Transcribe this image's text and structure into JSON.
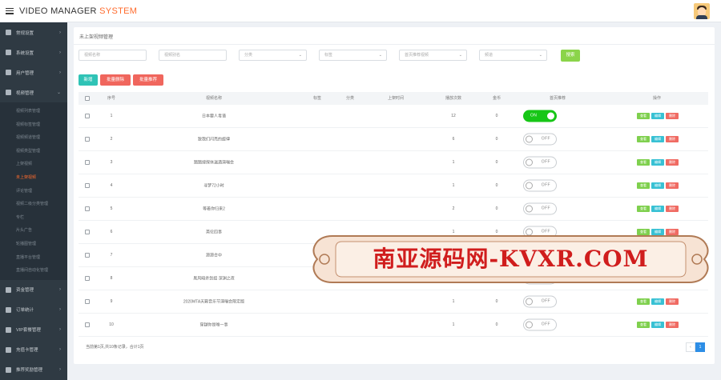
{
  "header": {
    "app_title_main": "VIDEO MANAGER ",
    "app_title_accent": "SYSTEM"
  },
  "sidebar": {
    "items_top": [
      {
        "label": "常规设置"
      },
      {
        "label": "系统设置"
      },
      {
        "label": "用户管理"
      },
      {
        "label": "视频管理"
      }
    ],
    "submenu": [
      {
        "label": "视频列表管理"
      },
      {
        "label": "视频标签管理"
      },
      {
        "label": "视频频道管理"
      },
      {
        "label": "视频类型管理"
      },
      {
        "label": "上架视频"
      },
      {
        "label": "未上架视频"
      },
      {
        "label": "评论管理"
      },
      {
        "label": "视频二级分类管理"
      },
      {
        "label": "专栏"
      },
      {
        "label": "片头广告"
      },
      {
        "label": "轮播图管理"
      },
      {
        "label": "直播平台管理"
      },
      {
        "label": "直播间自动化管理"
      }
    ],
    "items_bottom": [
      {
        "label": "资金管理"
      },
      {
        "label": "订单统计"
      },
      {
        "label": "VIP套餐管理"
      },
      {
        "label": "充值卡管理"
      },
      {
        "label": "推荐奖励管理"
      }
    ]
  },
  "page": {
    "title": "未上架视频管理"
  },
  "filters": {
    "video_name_placeholder": "视频名称",
    "alias_placeholder": "视频别名",
    "category": "分类",
    "tags": "标签",
    "home_recommend": "首页推荐视频",
    "channel": "频道",
    "search_label": "搜索"
  },
  "actions": {
    "add_label": "新增",
    "batch_delete_label": "批量删除",
    "batch_recommend_label": "批量推荐"
  },
  "table": {
    "columns": [
      "序号",
      "视频名称",
      "标签",
      "分类",
      "上架时间",
      "播放次数",
      "金币",
      "首页推荐",
      "操作"
    ],
    "rows": [
      {
        "index": "1",
        "name": "日本要人毒语",
        "plays": "12",
        "coins": "0",
        "recommend": true
      },
      {
        "index": "2",
        "name": "致我们闪亮的旋律",
        "plays": "6",
        "coins": "0",
        "recommend": false
      },
      {
        "index": "3",
        "name": "踏踏搜探休温酒演唱会",
        "plays": "1",
        "coins": "0",
        "recommend": false
      },
      {
        "index": "4",
        "name": "寻梦72小时",
        "plays": "1",
        "coins": "0",
        "recommend": false
      },
      {
        "index": "5",
        "name": "等着你归来2",
        "plays": "2",
        "coins": "0",
        "recommend": false
      },
      {
        "index": "6",
        "name": "英伦四事",
        "plays": "1",
        "coins": "0",
        "recommend": false
      },
      {
        "index": "7",
        "name": "源源合中",
        "plays": "",
        "coins": "",
        "recommend": false
      },
      {
        "index": "8",
        "name": "黑风暗杀剑组 深渊之夜",
        "plays": "",
        "coins": "",
        "recommend": false
      },
      {
        "index": "9",
        "name": "2020MTA天籁音乐节演唱会限定版",
        "plays": "1",
        "coins": "0",
        "recommend": false
      },
      {
        "index": "10",
        "name": "穿越你是唯一事",
        "plays": "1",
        "coins": "0",
        "recommend": false
      }
    ],
    "toggle_on": "ON",
    "toggle_off": "OFF",
    "op_view": "查看",
    "op_edit": "编辑",
    "op_delete": "删除"
  },
  "pagination": {
    "info": "当前第1页,共10条记录，合计1页",
    "prev": "‹",
    "current": "1"
  },
  "watermark": {
    "text": "南亚源码网-KVXR.COM"
  }
}
